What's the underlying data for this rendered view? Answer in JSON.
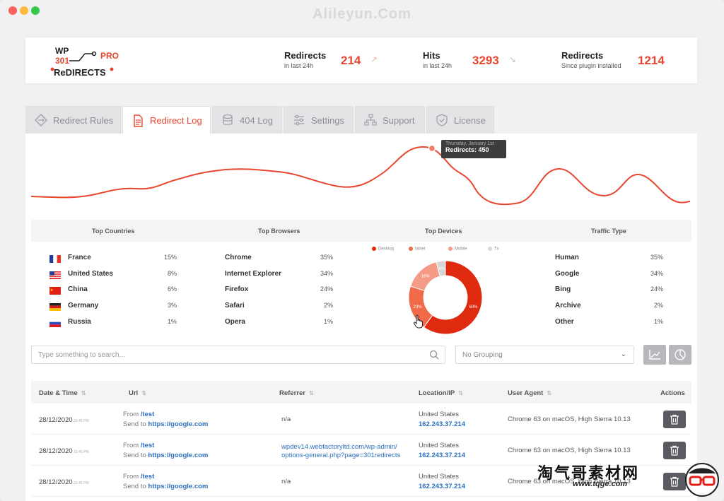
{
  "window": {
    "watermark": "Alileyun.Com"
  },
  "logo": {
    "line1": "WP",
    "line2": "301",
    "pro": "PRO",
    "line3": "ReDIRECTS"
  },
  "stats": [
    {
      "title": "Redirects",
      "sub": "in last 24h",
      "value": "214",
      "arrow": "↗",
      "arrow_color": "#f3b3a6"
    },
    {
      "title": "Hits",
      "sub": "in last 24h",
      "value": "3293",
      "arrow": "↘",
      "arrow_color": "#b9c0c8"
    },
    {
      "title": "Redirects",
      "sub": "Since plugin installed",
      "value": "1214"
    }
  ],
  "tabs": [
    {
      "label": "Redirect Rules",
      "icon": "diamond-arrows-icon"
    },
    {
      "label": "Redirect Log",
      "icon": "document-icon",
      "active": true
    },
    {
      "label": "404 Log",
      "icon": "database-icon"
    },
    {
      "label": "Settings",
      "icon": "sliders-icon"
    },
    {
      "label": "Support",
      "icon": "sitemap-icon"
    },
    {
      "label": "License",
      "icon": "shield-check-icon"
    }
  ],
  "chart": {
    "tooltip_date": "Thursday, January 1st",
    "tooltip_value": "Redirects: 450",
    "line_color": "#e8472f"
  },
  "stat_headers": [
    "Top Countries",
    "Top Browsers",
    "Top Devices",
    "Traffic Type"
  ],
  "countries": [
    {
      "name": "France",
      "pct": "15%",
      "flag": "france-flag-icon"
    },
    {
      "name": "United States",
      "pct": "8%",
      "flag": "usa-flag-icon"
    },
    {
      "name": "China",
      "pct": "6%",
      "flag": "china-flag-icon"
    },
    {
      "name": "Germany",
      "pct": "3%",
      "flag": "germany-flag-icon"
    },
    {
      "name": "Russia",
      "pct": "1%",
      "flag": "russia-flag-icon"
    }
  ],
  "browsers": [
    {
      "name": "Chrome",
      "pct": "35%"
    },
    {
      "name": "Internet Explorer",
      "pct": "34%"
    },
    {
      "name": "Firefox",
      "pct": "24%"
    },
    {
      "name": "Safari",
      "pct": "2%"
    },
    {
      "name": "Opera",
      "pct": "1%"
    }
  ],
  "devices": {
    "legend": [
      {
        "label": "Desktop",
        "color": "#e02a10"
      },
      {
        "label": "tablet",
        "color": "#f06a4a"
      },
      {
        "label": "Mobile",
        "color": "#f49a86"
      },
      {
        "label": "Tv",
        "color": "#d6d6d6"
      }
    ],
    "chart_data": {
      "type": "pie",
      "categories": [
        "Desktop",
        "tablet",
        "Mobile",
        "Tv"
      ],
      "values": [
        60,
        20,
        16,
        4
      ],
      "labels": [
        "60%",
        "20%",
        "16%",
        "4%"
      ]
    }
  },
  "traffic": [
    {
      "name": "Human",
      "pct": "35%"
    },
    {
      "name": "Google",
      "pct": "34%"
    },
    {
      "name": "Bing",
      "pct": "24%"
    },
    {
      "name": "Archive",
      "pct": "2%"
    },
    {
      "name": "Other",
      "pct": "1%"
    }
  ],
  "search": {
    "placeholder": "Type something to search..."
  },
  "grouping": {
    "value": "No Grouping"
  },
  "view_buttons": [
    "line-chart-icon",
    "pie-chart-icon"
  ],
  "table": {
    "headers": [
      "Date & Time",
      "Url",
      "Referrer",
      "Location/IP",
      "User Agent",
      "Actions"
    ],
    "from_label": "From",
    "send_label": "Send to",
    "rows": [
      {
        "date": "28/12/2020",
        "time": "11:45 PM",
        "from": "/test",
        "to": "https://google.com",
        "referrer": "n/a",
        "location": "United States",
        "ip": "162.243.37.214",
        "agent": "Chrome 63 on macOS, High Sierra 10.13"
      },
      {
        "date": "28/12/2020",
        "time": "11:45 PM",
        "from": "/test",
        "to": "https://google.com",
        "referrer_line1": "wpdev14.webfactoryltd.com/wp-admin/",
        "referrer_line2": "options-general.php?page=301redirects",
        "location": "United States",
        "ip": "162.243.37.214",
        "agent": "Chrome 63 on macOS, High Sierra 10.13"
      },
      {
        "date": "28/12/2020",
        "time": "11:45 PM",
        "from": "/test",
        "to": "https://google.com",
        "referrer": "n/a",
        "location": "United States",
        "ip": "162.243.37.214",
        "agent": "Chrome 63 on macOS, High Sierra 10.13"
      }
    ]
  },
  "site_watermark": {
    "name": "淘气哥素材网",
    "url": "www.tqge.com"
  }
}
